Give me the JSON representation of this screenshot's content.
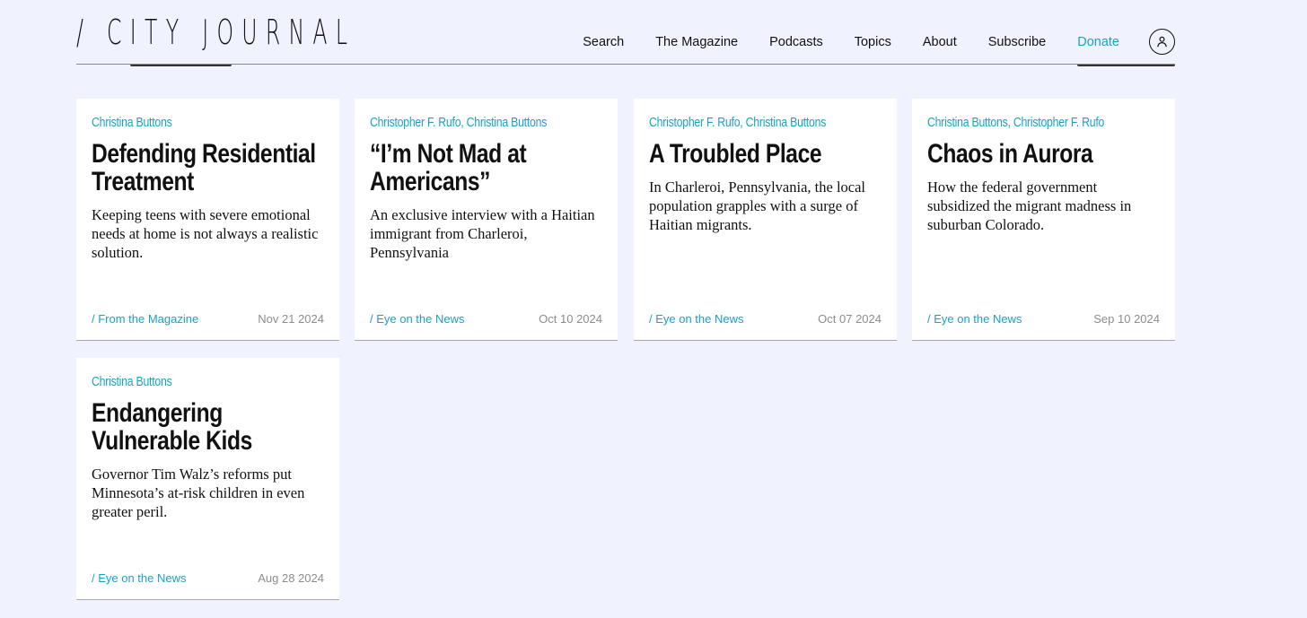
{
  "site": {
    "logo_text": "/ CITY JOURNAL"
  },
  "nav": {
    "items": [
      "Search",
      "The Magazine",
      "Podcasts",
      "Topics",
      "About",
      "Subscribe"
    ],
    "donate_label": "Donate",
    "account_icon": "user-icon"
  },
  "colors": {
    "accent": "#1ba1c5",
    "background": "#f0f2fd",
    "card": "#ffffff",
    "date": "#8c8c8c"
  },
  "articles": [
    {
      "authors": "Christina Buttons",
      "title": "Defending Residential Treatment",
      "dek": "Keeping teens with severe emotional needs at home is not always a realistic solution.",
      "section": "/ From the Magazine",
      "date": "Nov 21 2024"
    },
    {
      "authors": "Christopher F. Rufo, Christina Buttons",
      "title": "“I’m Not Mad at Americans”",
      "dek": "An exclusive interview with a Haitian immigrant from Charleroi, Pennsylvania",
      "section": "/ Eye on the News",
      "date": "Oct 10 2024"
    },
    {
      "authors": "Christopher F. Rufo, Christina Buttons",
      "title": "A Troubled Place",
      "dek": "In Charleroi, Pennsylvania, the local population grapples with a surge of Haitian migrants.",
      "section": "/ Eye on the News",
      "date": "Oct 07 2024"
    },
    {
      "authors": "Christina Buttons, Christopher F. Rufo",
      "title": "Chaos in Aurora",
      "dek": "How the federal government subsidized the migrant madness in suburban Colorado.",
      "section": "/ Eye on the News",
      "date": "Sep 10 2024"
    },
    {
      "authors": "Christina Buttons",
      "title": "Endangering Vulnerable Kids",
      "dek": "Governor Tim Walz’s reforms put Minnesota’s at-risk children in even greater peril.",
      "section": "/ Eye on the News",
      "date": "Aug 28 2024"
    }
  ]
}
